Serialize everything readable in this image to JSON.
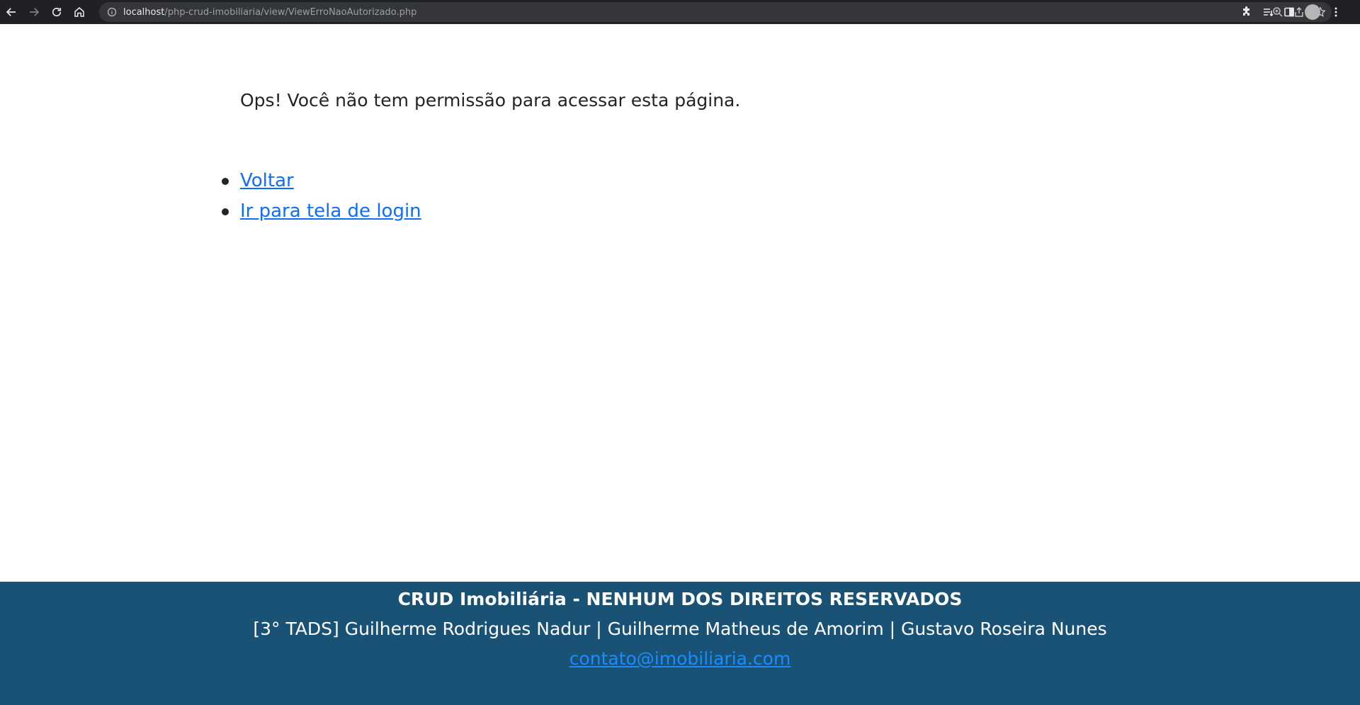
{
  "browser": {
    "url_host": "localhost",
    "url_path": "/php-crud-imobiliaria/view/ViewErroNaoAutorizado.php",
    "icons": {
      "back": "arrow-left-icon",
      "forward": "arrow-right-icon",
      "reload": "reload-icon",
      "home": "home-icon",
      "site_info": "info-icon",
      "zoom": "zoom-icon",
      "share": "share-icon",
      "bookmark": "star-icon",
      "extensions": "puzzle-icon",
      "reading_list": "reading-list-icon",
      "side_panel": "side-panel-icon",
      "profile": "avatar",
      "menu": "kebab-menu-icon"
    }
  },
  "main": {
    "message": "Ops! Você não tem permissão para acessar esta página.",
    "links": [
      {
        "label": "Voltar"
      },
      {
        "label": "Ir para tela de login"
      }
    ]
  },
  "footer": {
    "title": "CRUD Imobiliária - NENHUM DOS DIREITOS RESERVADOS",
    "authors": "[3° TADS] Guilherme Rodrigues Nadur | Guilherme Matheus de Amorim | Gustavo Roseira Nunes",
    "email": "contato@imobiliaria.com",
    "background": "#1a5276"
  },
  "colors": {
    "link": "#0d6efd",
    "text": "#212529",
    "chrome": "#202124"
  }
}
